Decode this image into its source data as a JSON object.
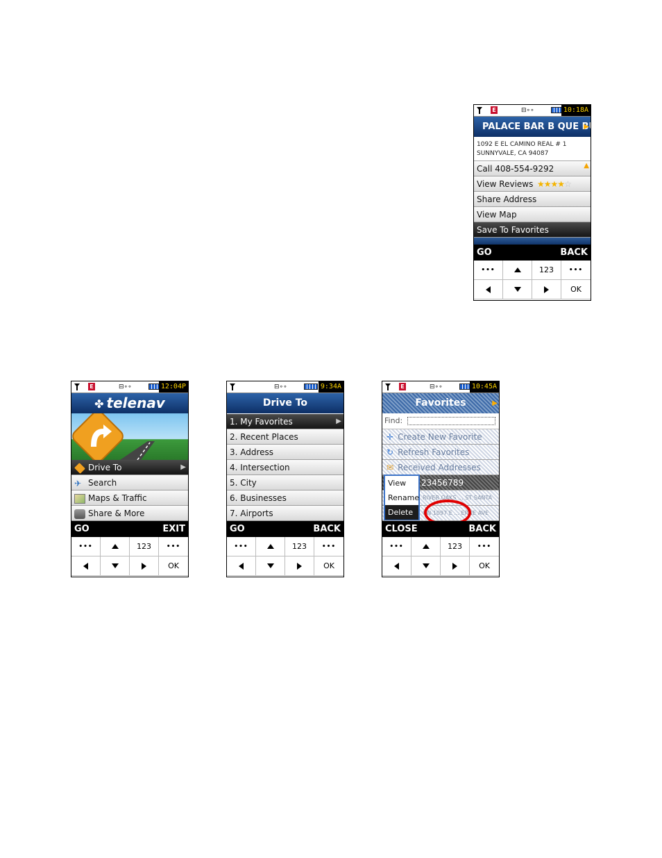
{
  "phone1": {
    "status_time": "10:18A",
    "title": "PALACE BAR B QUE BU",
    "address_line1": "1092 E EL CAMINO REAL # 1",
    "address_line2": "SUNNYVALE, CA 94087",
    "items": [
      "Call 408-554-9292",
      "View Reviews",
      "Share Address",
      "View Map",
      "Save To Favorites"
    ],
    "rating_stars": 4,
    "soft_left": "GO",
    "soft_right": "BACK"
  },
  "phone2": {
    "status_time": "12:04P",
    "brand": "telenav",
    "items": [
      "Drive To",
      "Search",
      "Maps & Traffic",
      "Share & More"
    ],
    "soft_left": "GO",
    "soft_right": "EXIT"
  },
  "phone3": {
    "status_time": "9:34A",
    "title": "Drive To",
    "items": [
      "1. My Favorites",
      "2. Recent Places",
      "3. Address",
      "4. Intersection",
      "5. City",
      "6. Businesses",
      "7. Airports"
    ],
    "soft_left": "GO",
    "soft_right": "BACK"
  },
  "phone4": {
    "status_time": "10:45A",
    "title": "Favorites",
    "find_label": "Find:",
    "items": [
      "Create New Favorite",
      "Refresh Favorites",
      "Received Addresses"
    ],
    "row_number": "23456789",
    "row_text1": "RIVER OAKS ... ST SANTA",
    "row_text2": "ON 1097 E ... ERNE AVE",
    "popup_items": [
      "View",
      "Rename",
      "Delete"
    ],
    "soft_left": "CLOSE",
    "soft_right": "BACK"
  },
  "keypad": {
    "dots": "•••",
    "num": "123",
    "ok": "OK"
  },
  "colors": {
    "title_bar": "#0d2f66",
    "time_text": "#ffd400",
    "highlight_oval": "#e00000"
  }
}
